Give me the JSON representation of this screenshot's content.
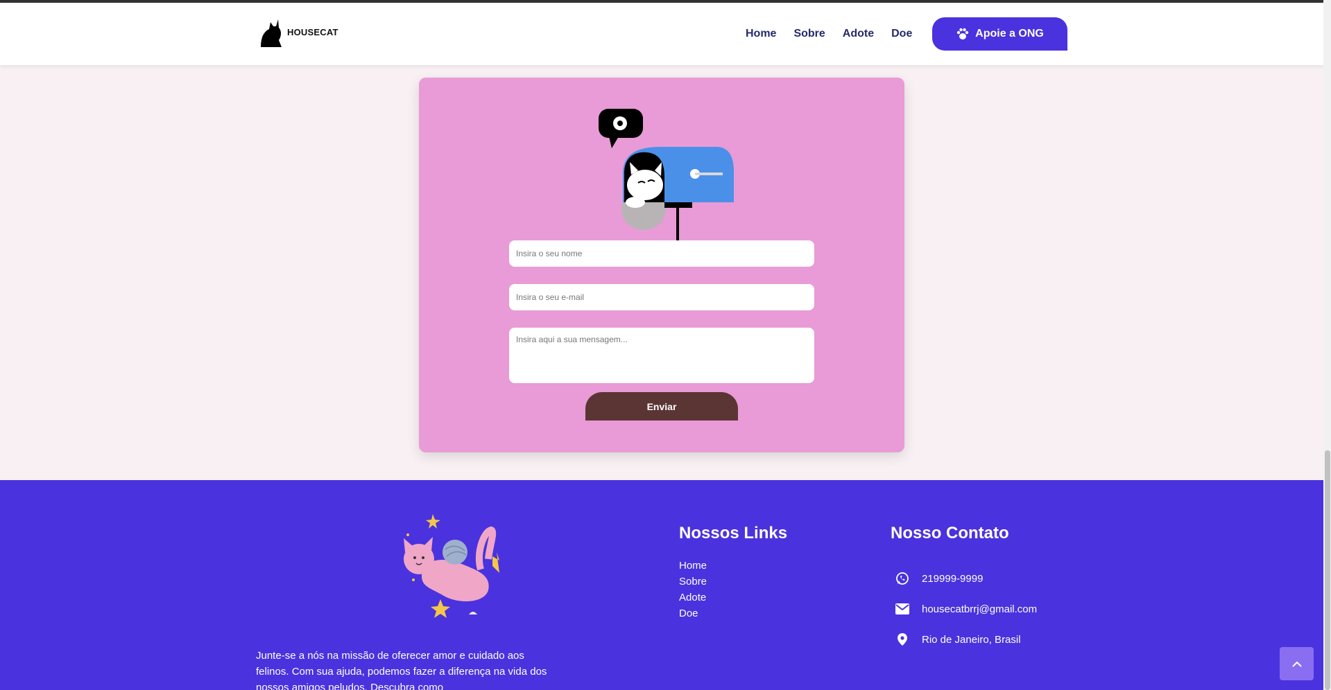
{
  "header": {
    "logo_text": "HOUSECAT",
    "nav": [
      "Home",
      "Sobre",
      "Adote",
      "Doe"
    ],
    "cta_label": "Apoie a ONG"
  },
  "contact_form": {
    "name_placeholder": "Insira o seu nome",
    "email_placeholder": "Insira o seu e-mail",
    "message_placeholder": "Insira aqui a sua mensagem...",
    "submit_label": "Enviar"
  },
  "footer": {
    "about_text": "Junte-se a nós na missão de oferecer amor e cuidado aos felinos. Com sua ajuda, podemos fazer a diferença na vida dos nossos amigos peludos. Descubra como",
    "links_title": "Nossos Links",
    "links": [
      "Home",
      "Sobre",
      "Adote",
      "Doe"
    ],
    "contact_title": "Nosso Contato",
    "phone": "219999-9999",
    "email": "housecatbrrj@gmail.com",
    "location": "Rio de Janeiro, Brasil"
  },
  "colors": {
    "brand": "#4a32de",
    "card": "#e89bd6",
    "nav_text": "#262a6b",
    "submit": "#5a3533",
    "page_bg": "#f8f0f2"
  }
}
